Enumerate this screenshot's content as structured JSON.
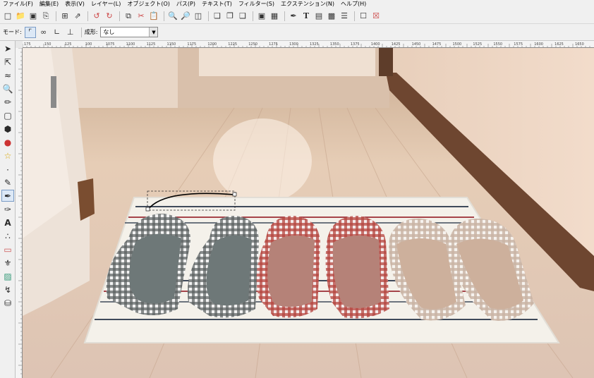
{
  "menubar": {
    "items": [
      {
        "label": "ファイル(F)"
      },
      {
        "label": "編集(E)"
      },
      {
        "label": "表示(V)"
      },
      {
        "label": "レイヤー(L)"
      },
      {
        "label": "オブジェクト(O)"
      },
      {
        "label": "パス(P)"
      },
      {
        "label": "テキスト(T)"
      },
      {
        "label": "フィルター(S)"
      },
      {
        "label": "エクステンション(N)"
      },
      {
        "label": "ヘルプ(H)"
      }
    ]
  },
  "tool_controls": {
    "mode_label": "モード:",
    "shape_label": "成形:",
    "shape_value": "なし"
  },
  "ruler": {
    "ticks": [
      "175",
      "150",
      "125",
      "100",
      "1075",
      "1100",
      "1125",
      "1150",
      "1175",
      "1200",
      "1225",
      "1250",
      "1275",
      "1300",
      "1325",
      "1350",
      "1375",
      "1400",
      "1425",
      "1450",
      "1475",
      "1500",
      "1525",
      "1550",
      "1575",
      "1600",
      "1625",
      "1650"
    ]
  },
  "colors": {
    "selection": "#3a6ea5",
    "floor": "#e2c6ae",
    "mat": "#f4f1ea"
  }
}
